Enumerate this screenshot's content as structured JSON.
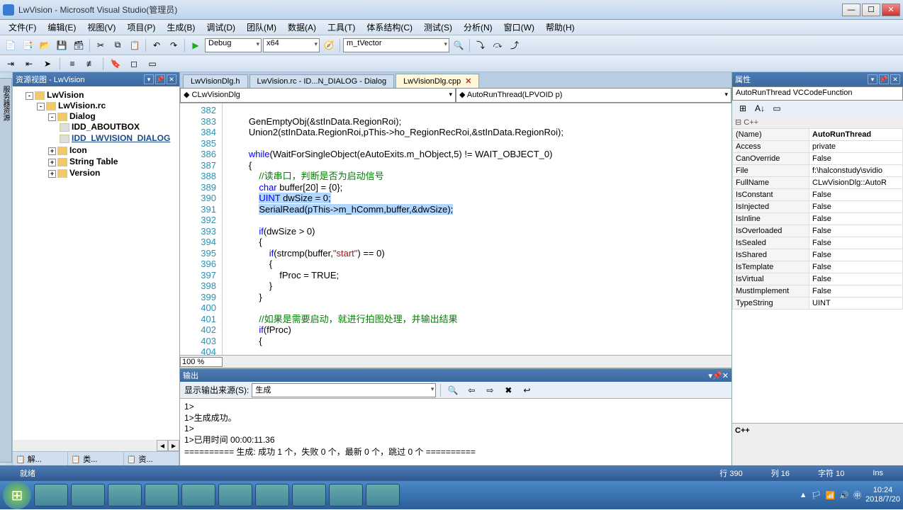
{
  "title": "LwVision - Microsoft Visual Studio(管理员)",
  "menu": [
    "文件(F)",
    "编辑(E)",
    "视图(V)",
    "项目(P)",
    "生成(B)",
    "调试(D)",
    "团队(M)",
    "数据(A)",
    "工具(T)",
    "体系结构(C)",
    "测试(S)",
    "分析(N)",
    "窗口(W)",
    "帮助(H)"
  ],
  "toolbar": {
    "config": "Debug",
    "platform": "x64",
    "find": "m_tVector"
  },
  "resourceView": {
    "title": "资源视图 - LwVision",
    "solution": "LwVision",
    "rc": "LwVision.rc",
    "folders": [
      {
        "name": "Dialog",
        "items": [
          "IDD_ABOUTBOX",
          "IDD_LWVISION_DIALOG"
        ]
      },
      {
        "name": "Icon"
      },
      {
        "name": "String Table"
      },
      {
        "name": "Version"
      }
    ],
    "footTabs": [
      "解...",
      "类...",
      "资..."
    ]
  },
  "tabs": [
    {
      "label": "LwVisionDlg.h"
    },
    {
      "label": "LwVision.rc - ID...N_DIALOG - Dialog"
    },
    {
      "label": "LwVisionDlg.cpp",
      "active": true
    }
  ],
  "codeCombo": {
    "class": "CLwVisionDlg",
    "func": "AutoRunThread(LPVOID p)"
  },
  "gutter_start": 382,
  "code_lines": [
    {
      "n": 382,
      "html": ""
    },
    {
      "n": 383,
      "html": "        GenEmptyObj(&stInData.RegionRoi);"
    },
    {
      "n": 384,
      "html": "        Union2(stInData.RegionRoi,pThis->ho_RegionRecRoi,&stInData.RegionRoi);"
    },
    {
      "n": 385,
      "html": ""
    },
    {
      "n": 386,
      "html": "        <span class=\"kw\">while</span>(WaitForSingleObject(eAutoExits.m_hObject,5) != WAIT_OBJECT_0)"
    },
    {
      "n": 387,
      "html": "        {"
    },
    {
      "n": 388,
      "html": "            <span class=\"cm\">//读串口，判断是否为启动信号</span>"
    },
    {
      "n": 389,
      "html": "            <span class=\"kw\">char</span> buffer[20] = {0};",
      "hl": false
    },
    {
      "n": 390,
      "html": "            <span class=\"hl\"><span class=\"kw\">UINT</span> dwSize = 0;</span>"
    },
    {
      "n": 391,
      "html": "            <span class=\"hl\">SerialRead(pThis->m_hComm,buffer,&dwSize);</span>"
    },
    {
      "n": 392,
      "html": ""
    },
    {
      "n": 393,
      "html": "            <span class=\"kw\">if</span>(dwSize > 0)"
    },
    {
      "n": 394,
      "html": "            {"
    },
    {
      "n": 395,
      "html": "                <span class=\"kw\">if</span>(strcmp(buffer,<span class=\"str\">\"start\"</span>) == 0)"
    },
    {
      "n": 396,
      "html": "                {"
    },
    {
      "n": 397,
      "html": "                    fProc = TRUE;"
    },
    {
      "n": 398,
      "html": "                }"
    },
    {
      "n": 399,
      "html": "            }"
    },
    {
      "n": 400,
      "html": ""
    },
    {
      "n": 401,
      "html": "            <span class=\"cm\">//如果是需要启动，就进行拍图处理，并输出结果</span>"
    },
    {
      "n": 402,
      "html": "            <span class=\"kw\">if</span>(fProc)"
    },
    {
      "n": 403,
      "html": "            {"
    },
    {
      "n": 404,
      "html": ""
    }
  ],
  "zoom": "100 %",
  "output": {
    "title": "输出",
    "srcLabel": "显示输出来源(S):",
    "src": "生成",
    "body": [
      "1>",
      "1>生成成功。",
      "1>",
      "1>已用时间 00:00:11.36",
      "========== 生成: 成功 1 个，失败 0 个，最新 0 个，跳过 0 个 =========="
    ]
  },
  "props": {
    "title": "属性",
    "subject": "AutoRunThread VCCodeFunction",
    "cat": "C++",
    "rows": [
      [
        "(Name)",
        "AutoRunThread"
      ],
      [
        "Access",
        "private"
      ],
      [
        "CanOverride",
        "False"
      ],
      [
        "File",
        "f:\\halconstudy\\svidio"
      ],
      [
        "FullName",
        "CLwVisionDlg::AutoR"
      ],
      [
        "IsConstant",
        "False"
      ],
      [
        "IsInjected",
        "False"
      ],
      [
        "IsInline",
        "False"
      ],
      [
        "IsOverloaded",
        "False"
      ],
      [
        "IsSealed",
        "False"
      ],
      [
        "IsShared",
        "False"
      ],
      [
        "IsTemplate",
        "False"
      ],
      [
        "IsVirtual",
        "False"
      ],
      [
        "MustImplement",
        "False"
      ],
      [
        "TypeString",
        "UINT"
      ]
    ],
    "foot": "C++"
  },
  "status": {
    "ready": "就绪",
    "line": "行 390",
    "col": "列 16",
    "ch": "字符 10",
    "ins": "Ins"
  },
  "clock": {
    "time": "10:24",
    "date": "2018/7/20"
  }
}
